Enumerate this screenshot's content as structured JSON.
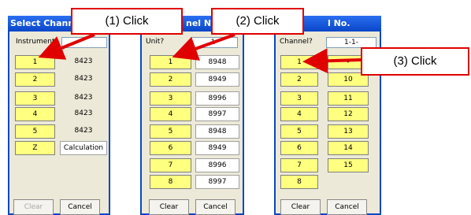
{
  "dialog1": {
    "title": "Select Channel",
    "header_label": "Instrument",
    "buttons": [
      "1",
      "2",
      "3",
      "4",
      "5",
      "Z"
    ],
    "values": [
      "8423",
      "8423",
      "8423",
      "8423",
      "8423",
      "Calculation"
    ],
    "clear_label": "Clear",
    "cancel_label": "Cancel"
  },
  "dialog2": {
    "title": "nel N",
    "header_label": "Unit?",
    "header_value": "1-",
    "buttons": [
      "1",
      "2",
      "3",
      "4",
      "5",
      "6",
      "7",
      "8"
    ],
    "values": [
      "8948",
      "8949",
      "8996",
      "8997",
      "8948",
      "8949",
      "8996",
      "8997"
    ],
    "clear_label": "Clear",
    "cancel_label": "Cancel"
  },
  "dialog3": {
    "title": "l No.",
    "header_label": "Channel?",
    "header_value": "1-1-",
    "buttons_left": [
      "1",
      "2",
      "3",
      "4",
      "5",
      "6",
      "7",
      "8"
    ],
    "buttons_right": [
      "-",
      "10",
      "11",
      "12",
      "13",
      "14",
      "15"
    ],
    "clear_label": "Clear",
    "cancel_label": "Cancel"
  },
  "callouts": {
    "c1": "(1) Click",
    "c2": "(2) Click",
    "c3": "(3) Click"
  },
  "colors": {
    "callout_border": "#e00000",
    "button_yellow": "#ffff80",
    "titlebar_blue": "#0a46c8"
  }
}
